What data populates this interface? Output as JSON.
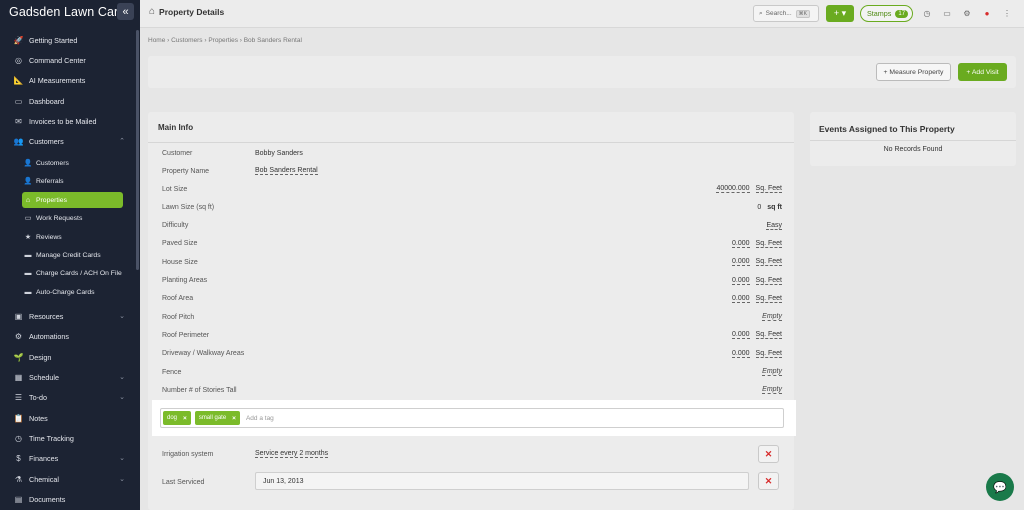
{
  "app": {
    "brand": "Gadsden Lawn Care",
    "collapse_icon": "«"
  },
  "sidebar": {
    "items": [
      {
        "label": "Getting Started",
        "icon": "rocket-icon",
        "glyph": "🚀"
      },
      {
        "label": "Command Center",
        "icon": "target-icon",
        "glyph": "◎"
      },
      {
        "label": "AI Measurements",
        "icon": "ruler-icon",
        "glyph": "📐"
      },
      {
        "label": "Dashboard",
        "icon": "monitor-icon",
        "glyph": "▭"
      },
      {
        "label": "Invoices to be Mailed",
        "icon": "envelope-icon",
        "glyph": "✉"
      },
      {
        "label": "Customers",
        "icon": "users-icon",
        "glyph": "👥",
        "chevron": "⌃"
      },
      {
        "label": "Resources",
        "icon": "box-icon",
        "glyph": "▣",
        "chevron": "⌄"
      },
      {
        "label": "Automations",
        "icon": "cogs-icon",
        "glyph": "⚙"
      },
      {
        "label": "Design",
        "icon": "sprout-icon",
        "glyph": "🌱"
      },
      {
        "label": "Schedule",
        "icon": "calendar-icon",
        "glyph": "▦",
        "chevron": "⌄"
      },
      {
        "label": "To-do",
        "icon": "checklist-icon",
        "glyph": "☰",
        "chevron": "⌄"
      },
      {
        "label": "Notes",
        "icon": "clipboard-icon",
        "glyph": "📋"
      },
      {
        "label": "Time Tracking",
        "icon": "clock-icon",
        "glyph": "◷"
      },
      {
        "label": "Finances",
        "icon": "dollar-icon",
        "glyph": "$",
        "chevron": "⌄"
      },
      {
        "label": "Chemical",
        "icon": "flask-icon",
        "glyph": "⚗",
        "chevron": "⌄"
      },
      {
        "label": "Documents",
        "icon": "file-icon",
        "glyph": "▤"
      }
    ],
    "sub_items": [
      {
        "label": "Customers",
        "icon": "user-icon",
        "glyph": "👤"
      },
      {
        "label": "Referrals",
        "icon": "user-plus-icon",
        "glyph": "👤"
      },
      {
        "label": "Properties",
        "icon": "home-icon",
        "glyph": "⌂",
        "active": true
      },
      {
        "label": "Work Requests",
        "icon": "id-card-icon",
        "glyph": "▭"
      },
      {
        "label": "Reviews",
        "icon": "star-icon",
        "glyph": "★"
      },
      {
        "label": "Manage Credit Cards",
        "icon": "credit-card-icon",
        "glyph": "▬"
      },
      {
        "label": "Charge Cards / ACH On File",
        "icon": "credit-card-icon",
        "glyph": "▬"
      },
      {
        "label": "Auto-Charge Cards",
        "icon": "credit-card-icon",
        "glyph": "▬"
      }
    ]
  },
  "header": {
    "title": "Property Details",
    "search_placeholder": "Search...",
    "search_shortcut": "⌘K",
    "plus_label": "+ ▾",
    "stamps_label": "Stamps",
    "stamps_count": "17"
  },
  "breadcrumb": "Home › Customers › Properties › Bob Sanders Rental",
  "actions": {
    "measure": "+ Measure Property",
    "add_visit": "+ Add Visit"
  },
  "main_info": {
    "title": "Main Info",
    "customer": {
      "label": "Customer",
      "value": "Bobby Sanders"
    },
    "property_name": {
      "label": "Property Name",
      "value": "Bob Sanders Rental"
    },
    "rows": [
      {
        "label": "Lot Size",
        "num": "40000.000",
        "unit": "Sq. Feet"
      },
      {
        "label": "Lawn Size (sq ft)",
        "plain": "0",
        "bold_unit": "sq ft"
      },
      {
        "label": "Difficulty",
        "text": "Easy"
      },
      {
        "label": "Paved Size",
        "num": "0.000",
        "unit": "Sq. Feet"
      },
      {
        "label": "House Size",
        "num": "0.000",
        "unit": "Sq. Feet"
      },
      {
        "label": "Planting Areas",
        "num": "0.000",
        "unit": "Sq. Feet"
      },
      {
        "label": "Roof Area",
        "num": "0.000",
        "unit": "Sq. Feet"
      },
      {
        "label": "Roof Pitch",
        "empty": "Empty"
      },
      {
        "label": "Roof Perimeter",
        "num": "0.000",
        "unit": "Sq. Feet"
      },
      {
        "label": "Driveway / Walkway Areas",
        "num": "0.000",
        "unit": "Sq. Feet"
      },
      {
        "label": "Fence",
        "empty": "Empty"
      },
      {
        "label": "Number # of Stories Tall",
        "empty": "Empty"
      }
    ],
    "tags": [
      "dog",
      "small gate"
    ],
    "tag_placeholder": "Add a tag",
    "irrigation": {
      "label": "Irrigation system",
      "value": "Service every 2 months"
    },
    "last_serviced": {
      "label": "Last Serviced",
      "value": "Jun 13, 2013"
    }
  },
  "events": {
    "title": "Events Assigned to This Property",
    "empty": "No Records Found"
  }
}
